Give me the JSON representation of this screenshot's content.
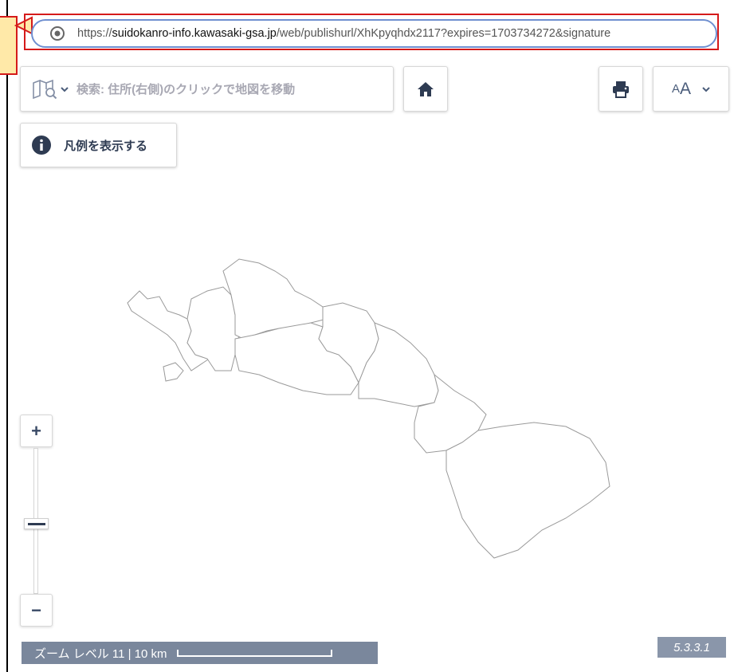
{
  "address_bar": {
    "url_host": "https://suidokanro-info.kawasaki-gsa.jp",
    "url_host_prefix": "https://",
    "url_host_domain": "suidokanro-info.kawasaki-gsa.jp",
    "url_path": "/web/publishurl/XhKpyqhdx2117?expires=1703734272&signature",
    "site_icon": "site-info-icon"
  },
  "toolbar": {
    "search_placeholder": "検索: 住所(右側)のクリックで地図を移動",
    "map_icon": "map-search-icon",
    "home_icon": "home-icon",
    "print_icon": "printer-icon",
    "font_size_small": "A",
    "font_size_big": "A"
  },
  "legend": {
    "label": "凡例を表示する",
    "icon": "info-icon"
  },
  "zoom": {
    "in_label": "+",
    "out_label": "−",
    "level": 11
  },
  "scale": {
    "text": "ズーム レベル 11 | 10 km"
  },
  "version": "5.3.3.1",
  "colors": {
    "highlight": "#d51a1a",
    "url_border": "#6f8fd0",
    "scale_bg": "#7a879c",
    "version_bg": "#8a96aa",
    "icon": "#2e3b52"
  }
}
